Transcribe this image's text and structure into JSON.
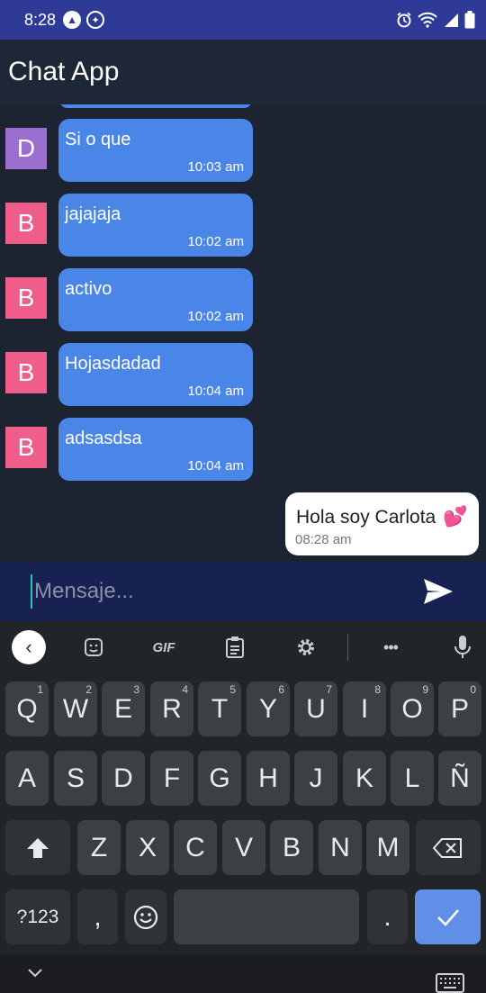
{
  "status_bar": {
    "time": "8:28"
  },
  "app_bar": {
    "title": "Chat App"
  },
  "messages": [
    {
      "avatar": "D",
      "avatar_color": "#9b6fcf",
      "text": "Si o que",
      "time": "10:03 am"
    },
    {
      "avatar": "B",
      "avatar_color": "#ef5d8a",
      "text": "jajajaja",
      "time": "10:02 am"
    },
    {
      "avatar": "B",
      "avatar_color": "#ef5d8a",
      "text": "activo",
      "time": "10:02 am"
    },
    {
      "avatar": "B",
      "avatar_color": "#ef5d8a",
      "text": "Hojasdadad",
      "time": "10:04 am"
    },
    {
      "avatar": "B",
      "avatar_color": "#ef5d8a",
      "text": "adsasdsa",
      "time": "10:04 am"
    }
  ],
  "outgoing": {
    "text": "Hola soy Carlota",
    "emoji": "💕",
    "time": "08:28 am"
  },
  "input": {
    "placeholder": "Mensaje..."
  },
  "keyboard": {
    "toolbar": {
      "gif_label": "GIF",
      "more": "•••"
    },
    "row1": [
      [
        "Q",
        "1"
      ],
      [
        "W",
        "2"
      ],
      [
        "E",
        "3"
      ],
      [
        "R",
        "4"
      ],
      [
        "T",
        "5"
      ],
      [
        "Y",
        "6"
      ],
      [
        "U",
        "7"
      ],
      [
        "I",
        "8"
      ],
      [
        "O",
        "9"
      ],
      [
        "P",
        "0"
      ]
    ],
    "row2": [
      "A",
      "S",
      "D",
      "F",
      "G",
      "H",
      "J",
      "K",
      "L",
      "Ñ"
    ],
    "row3": [
      "Z",
      "X",
      "C",
      "V",
      "B",
      "N",
      "M"
    ],
    "symbols_label": "?123",
    "comma": ",",
    "period": "."
  },
  "colors": {
    "incoming_bubble": "#4a86e8",
    "header": "#2f3a96",
    "input_bar": "#172152",
    "enter_key": "#5f8fe6"
  },
  "icons": [
    "alarm-icon",
    "wifi-icon",
    "signal-icon",
    "battery-icon",
    "send-icon",
    "sticker-icon",
    "clipboard-icon",
    "gear-icon",
    "mic-icon",
    "shift-icon",
    "backspace-icon",
    "emoji-icon",
    "check-icon",
    "chevron-down-icon",
    "keyboard-icon"
  ]
}
